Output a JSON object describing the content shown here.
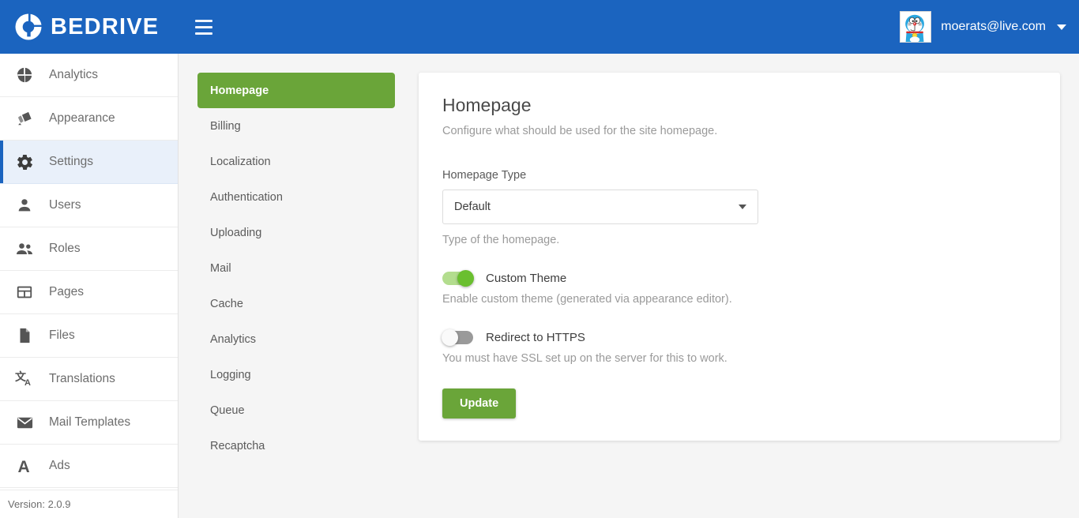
{
  "colors": {
    "header_blue": "#1b64bf",
    "accent_green": "#6aa539",
    "active_nav_bg": "#e9f0fa",
    "page_bg": "#f5f5f5",
    "toggle_on": "#6abf2f",
    "toggle_off": "#9a9a9a"
  },
  "topbar": {
    "logo_icon": "bedrive-c-logo-icon",
    "brand": "BEDRIVE",
    "menu_icon": "hamburger-menu-icon",
    "avatar_icon": "doraemon-avatar-image",
    "user_email": "moerats@live.com",
    "caret_icon": "chevron-down-icon"
  },
  "sidebar": {
    "items": [
      {
        "label": "Analytics",
        "icon": "pie-chart-icon",
        "active": false
      },
      {
        "label": "Appearance",
        "icon": "paint-roller-icon",
        "active": false
      },
      {
        "label": "Settings",
        "icon": "gear-icon",
        "active": true
      },
      {
        "label": "Users",
        "icon": "person-icon",
        "active": false
      },
      {
        "label": "Roles",
        "icon": "people-group-icon",
        "active": false
      },
      {
        "label": "Pages",
        "icon": "page-layout-icon",
        "active": false
      },
      {
        "label": "Files",
        "icon": "file-icon",
        "active": false
      },
      {
        "label": "Translations",
        "icon": "translate-icon",
        "active": false
      },
      {
        "label": "Mail Templates",
        "icon": "envelope-icon",
        "active": false
      },
      {
        "label": "Ads",
        "icon": "letter-a-icon",
        "active": false
      }
    ],
    "version": "Version: 2.0.9"
  },
  "settings_nav": {
    "tabs": [
      {
        "label": "Homepage",
        "active": true
      },
      {
        "label": "Billing",
        "active": false
      },
      {
        "label": "Localization",
        "active": false
      },
      {
        "label": "Authentication",
        "active": false
      },
      {
        "label": "Uploading",
        "active": false
      },
      {
        "label": "Mail",
        "active": false
      },
      {
        "label": "Cache",
        "active": false
      },
      {
        "label": "Analytics",
        "active": false
      },
      {
        "label": "Logging",
        "active": false
      },
      {
        "label": "Queue",
        "active": false
      },
      {
        "label": "Recaptcha",
        "active": false
      }
    ]
  },
  "panel": {
    "title": "Homepage",
    "subtitle": "Configure what should be used for the site homepage.",
    "homepage_type": {
      "label": "Homepage Type",
      "value": "Default",
      "hint": "Type of the homepage.",
      "arrow_icon": "triangle-down-icon"
    },
    "custom_theme": {
      "label": "Custom Theme",
      "hint": "Enable custom theme (generated via appearance editor).",
      "state": "on"
    },
    "redirect_https": {
      "label": "Redirect to HTTPS",
      "hint": "You must have SSL set up on the server for this to work.",
      "state": "off"
    },
    "update_label": "Update"
  }
}
